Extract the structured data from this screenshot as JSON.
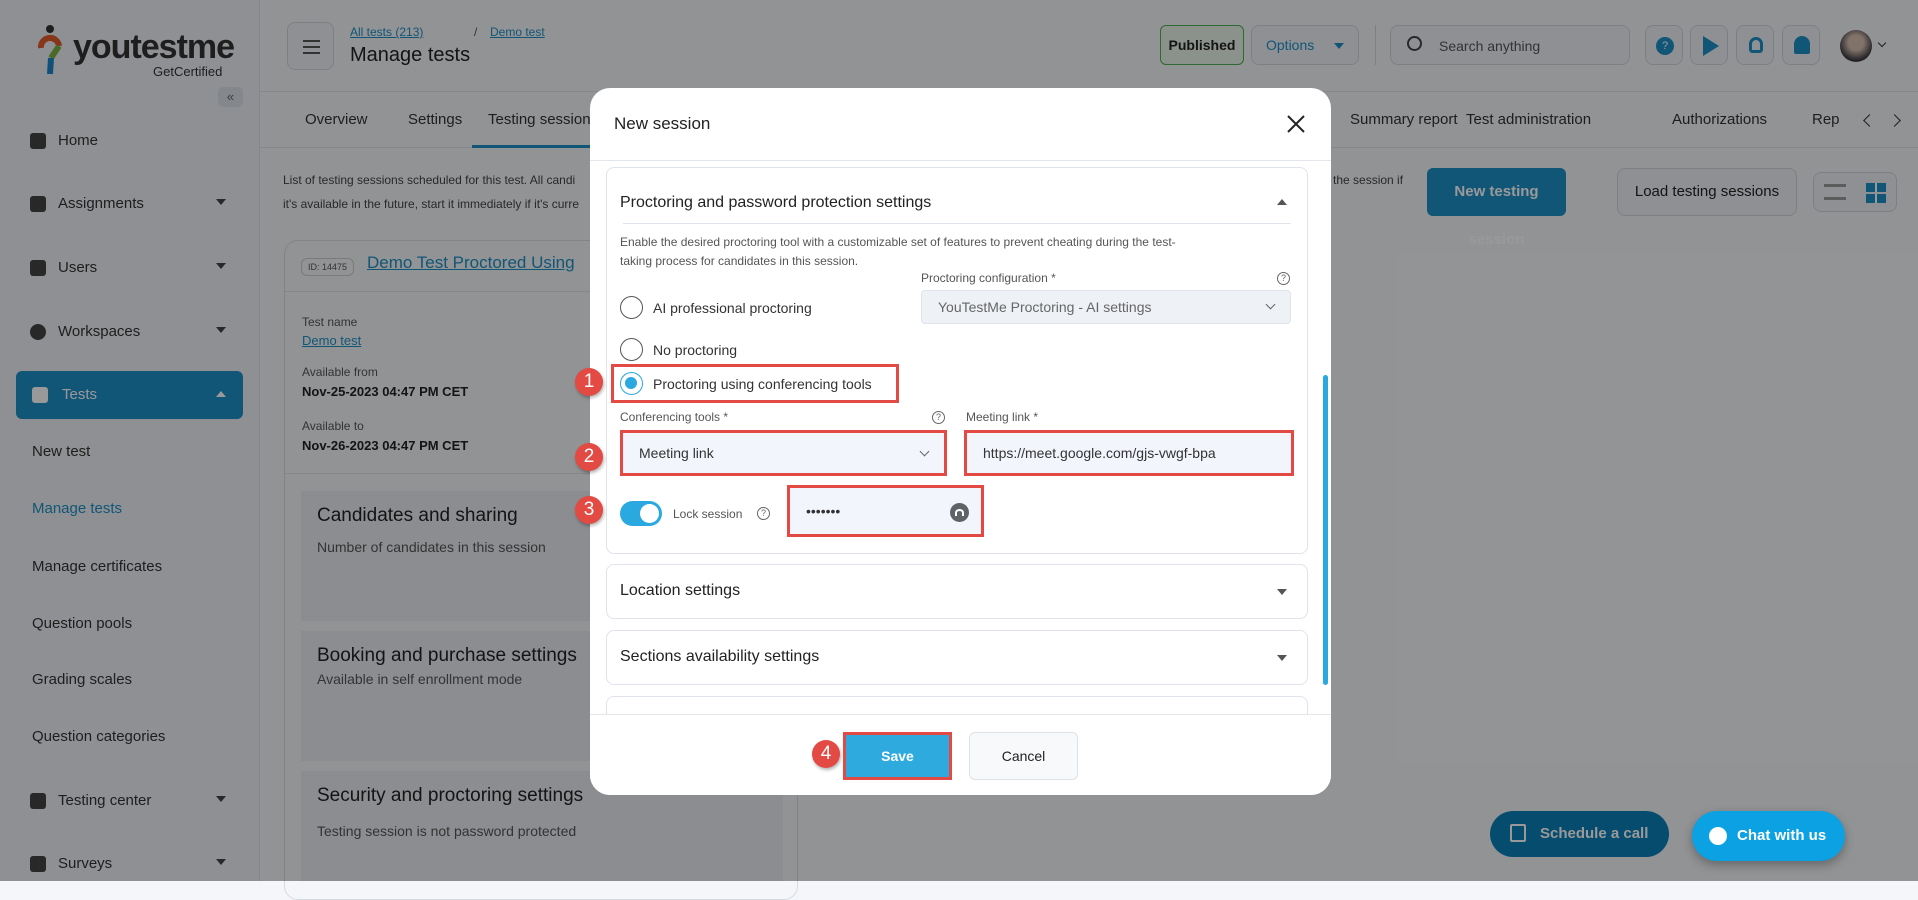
{
  "brand": {
    "name": "youtestme",
    "tagline": "GetCertified"
  },
  "sidebar": {
    "items": [
      {
        "label": "Home",
        "icon": "home-icon"
      },
      {
        "label": "Assignments",
        "icon": "assignments-icon"
      },
      {
        "label": "Users",
        "icon": "users-icon"
      },
      {
        "label": "Workspaces",
        "icon": "globe-icon"
      },
      {
        "label": "Tests",
        "icon": "tests-icon"
      },
      {
        "label": "New test"
      },
      {
        "label": "Manage tests"
      },
      {
        "label": "Manage certificates"
      },
      {
        "label": "Question pools"
      },
      {
        "label": "Grading scales"
      },
      {
        "label": "Question categories"
      },
      {
        "label": "Testing center",
        "icon": "testing-center-icon"
      },
      {
        "label": "Surveys",
        "icon": "surveys-icon"
      }
    ]
  },
  "header": {
    "breadcrumb": [
      "All tests (213)",
      "Demo test"
    ],
    "title": "Manage tests",
    "status": "Published",
    "options": "Options",
    "search_placeholder": "Search anything"
  },
  "tabs": [
    "Overview",
    "Settings",
    "Testing sessions",
    "Summary report",
    "Test administration",
    "Authorizations",
    "Rep"
  ],
  "main": {
    "description_1": "List of testing sessions scheduled for this test. All candi",
    "description_2": "it's available in the future, start it immediately if it's curre",
    "description_right": "the session if",
    "new_session": "New testing session",
    "load_sessions": "Load testing sessions",
    "card": {
      "id": "ID: 14475",
      "title": "Demo Test Proctored Using",
      "test_name_label": "Test name",
      "test_name": "Demo test",
      "from_label": "Available from",
      "from": "Nov-25-2023 04:47 PM CET",
      "to_label": "Available to",
      "to": "Nov-26-2023 04:47 PM CET",
      "sections": [
        {
          "title": "Candidates and sharing",
          "subtitle": "Number of candidates in this session"
        },
        {
          "title": "Booking and purchase settings",
          "subtitle": "Available in self enrollment mode"
        },
        {
          "title": "Security and proctoring settings",
          "subtitle": "Testing session is not password protected"
        }
      ]
    }
  },
  "modal": {
    "title": "New session",
    "proctoring": {
      "title": "Proctoring and password protection settings",
      "description": "Enable the desired proctoring tool with a customizable set of features to prevent cheating during the test-taking process for candidates in this session.",
      "config_label": "Proctoring configuration *",
      "config_value": "YouTestMe Proctoring - AI settings",
      "options": [
        "AI professional proctoring",
        "No proctoring",
        "Proctoring using conferencing tools"
      ],
      "selected": "Proctoring using conferencing tools",
      "tools_label": "Conferencing tools *",
      "tools_value": "Meeting link",
      "link_label": "Meeting link  *",
      "link_value": "https://meet.google.com/gjs-vwgf-bpa",
      "lock_label": "Lock session",
      "lock_on": true,
      "password": "•••••••"
    },
    "location": "Location settings",
    "sections": "Sections availability settings",
    "save": "Save",
    "cancel": "Cancel"
  },
  "annotations": [
    "1",
    "2",
    "3",
    "4"
  ],
  "floating": {
    "schedule": "Schedule a call",
    "chat": "Chat with us"
  },
  "colors": {
    "primary": "#2aa8e0",
    "annotation": "#e24a43",
    "published_border": "#4caf50"
  }
}
